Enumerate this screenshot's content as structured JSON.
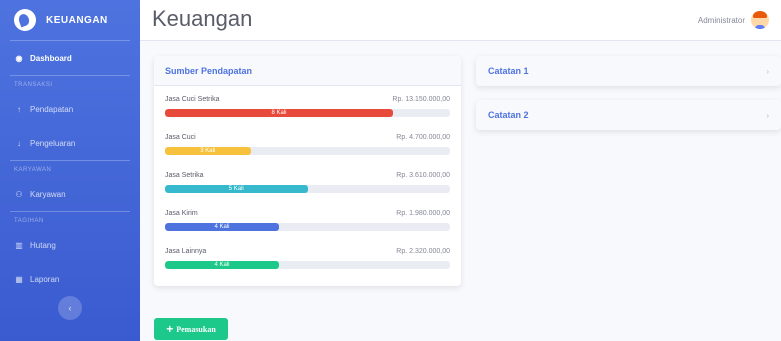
{
  "brand": {
    "name": "KEUANGAN"
  },
  "sidebar": {
    "dashboard": "Dashboard",
    "sections": [
      {
        "heading": "TRANSAKSI",
        "items": [
          {
            "label": "Pendapatan",
            "icon": "arrow-up-icon",
            "glyph": "↑"
          },
          {
            "label": "Pengeluaran",
            "icon": "arrow-down-icon",
            "glyph": "↓"
          }
        ]
      },
      {
        "heading": "KARYAWAN",
        "items": [
          {
            "label": "Karyawan",
            "icon": "users-icon",
            "glyph": "👥"
          }
        ]
      },
      {
        "heading": "TAGIHAN",
        "items": [
          {
            "label": "Hutang",
            "icon": "chart-bars-icon",
            "glyph": "📊"
          },
          {
            "label": "Laporan",
            "icon": "table-icon",
            "glyph": "▦"
          }
        ]
      }
    ],
    "toggle": "‹"
  },
  "topbar": {
    "title": "Keuangan",
    "user": "Administrator"
  },
  "income_card": {
    "title": "Sumber Pendapatan",
    "rows": [
      {
        "name": "Jasa Cuci Setrika",
        "amount": "Rp. 13.150.000,00",
        "count": "8 Kali",
        "fill": 0.8,
        "color": "#e74a3b"
      },
      {
        "name": "Jasa Cuci",
        "amount": "Rp. 4.700.000,00",
        "count": "3 Kali",
        "fill": 0.3,
        "color": "#f6c23e"
      },
      {
        "name": "Jasa Setrika",
        "amount": "Rp. 3.610.000,00",
        "count": "5 Kali",
        "fill": 0.5,
        "color": "#36b9cc"
      },
      {
        "name": "Jasa Kirim",
        "amount": "Rp. 1.980.000,00",
        "count": "4 Kali",
        "fill": 0.4,
        "color": "#4e73df"
      },
      {
        "name": "Jasa Lainnya",
        "amount": "Rp. 2.320.000,00",
        "count": "4 Kali",
        "fill": 0.4,
        "color": "#1cc88a"
      }
    ]
  },
  "notes": [
    {
      "title": "Catatan 1"
    },
    {
      "title": "Catatan 2"
    }
  ],
  "add_button": {
    "label": "Pemasukan"
  }
}
